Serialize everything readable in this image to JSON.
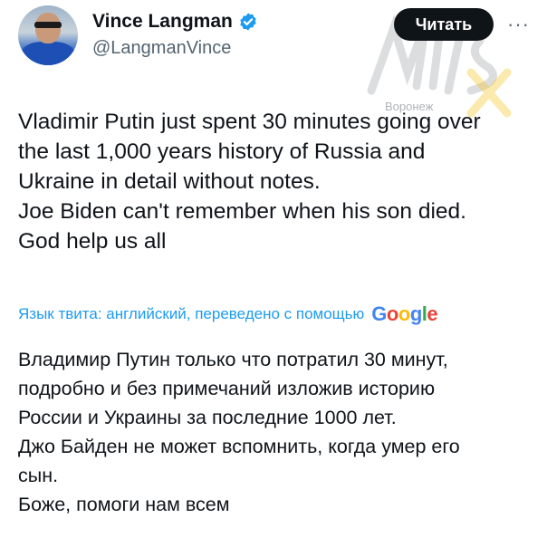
{
  "author": {
    "name": "Vince Langman",
    "handle": "@LangmanVince",
    "verified": true
  },
  "follow_button": {
    "label": "Читать"
  },
  "more_icon": "more-horizontal-icon",
  "watermark": {
    "city": "Воронеж"
  },
  "tweet": {
    "lines": [
      "Vladimir Putin just spent 30 minutes going over",
      "the last 1,000 years history of Russia and",
      "Ukraine in detail without notes.",
      "Joe Biden can't remember when his son died.",
      "God help us all"
    ]
  },
  "translation_notice": {
    "text": "Язык твита: английский, переведено с помощью",
    "provider": "Google"
  },
  "translation": {
    "lines": [
      "Владимир Путин только что потратил 30 минут,",
      "подробно и без примечаний изложив историю",
      "России и Украины за последние 1000 лет.",
      "Джо Байден не может вспомнить, когда умер его",
      "сын.",
      "Боже, помоги нам всем"
    ]
  },
  "colors": {
    "text": "#0f1419",
    "secondary": "#536471",
    "link": "#1d9bf0",
    "button_bg": "#0f1419",
    "verified": "#1d9bf0"
  }
}
